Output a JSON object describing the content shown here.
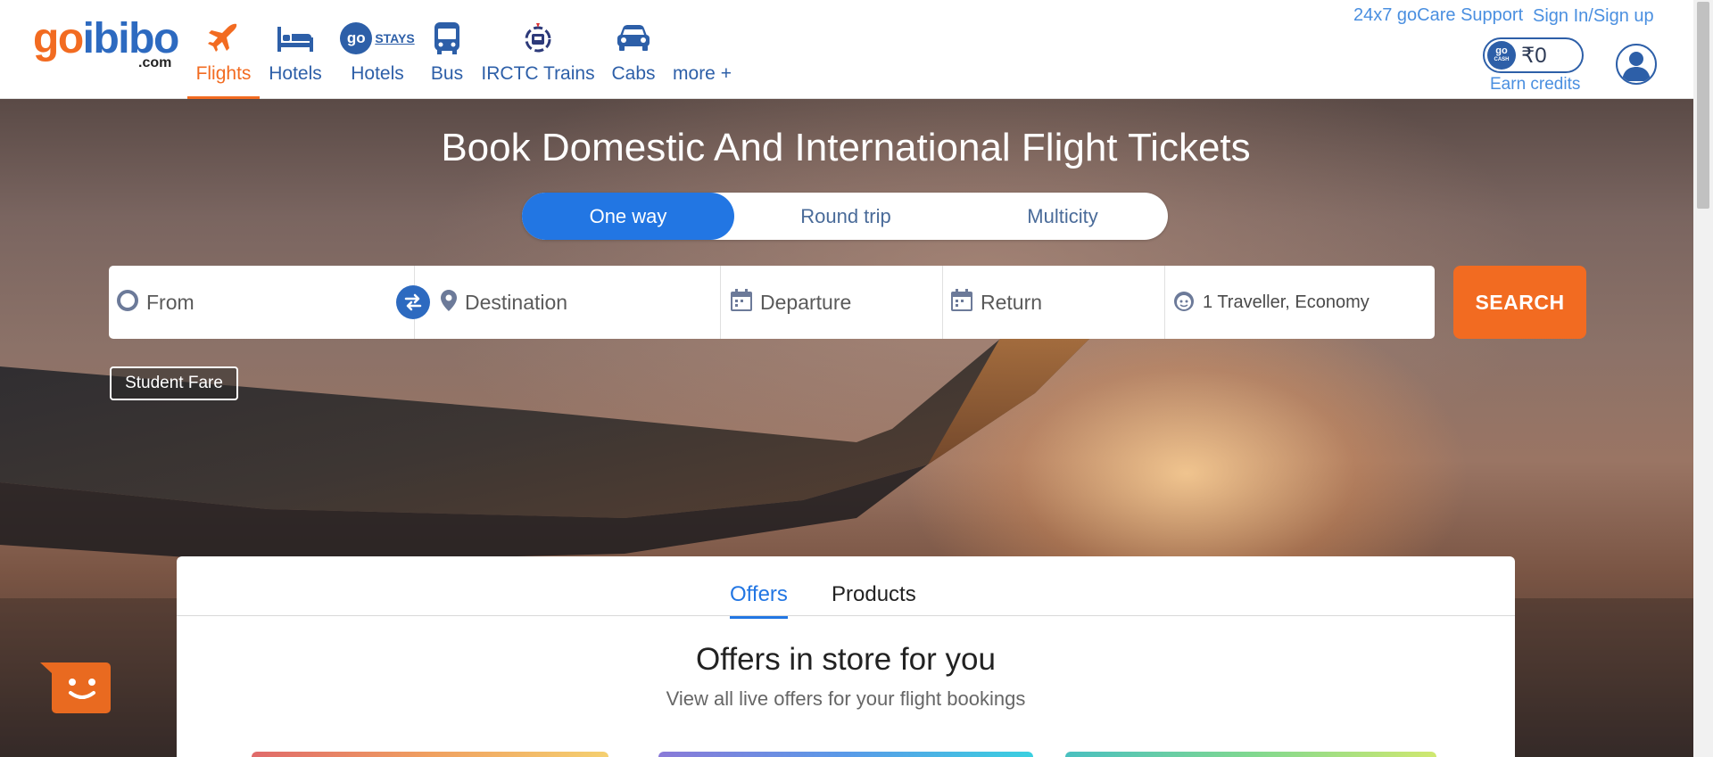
{
  "header": {
    "logo": {
      "word_go": "go",
      "word_ibibo": "ibibo",
      "suffix": ".com"
    },
    "nav": [
      {
        "label": "Flights",
        "icon": "airplane-icon",
        "active": true
      },
      {
        "label": "Hotels",
        "icon": "bed-icon"
      },
      {
        "label": "Hotels",
        "icon": "gostays-icon",
        "badge": "STAYS",
        "badge_prefix": "go"
      },
      {
        "label": "Bus",
        "icon": "bus-icon"
      },
      {
        "label": "IRCTC Trains",
        "icon": "irctc-icon"
      },
      {
        "label": "Cabs",
        "icon": "car-icon"
      },
      {
        "label": "more +"
      }
    ],
    "support_link": "24x7 goCare Support",
    "signin_link": "Sign In/Sign up",
    "gocash": {
      "coin_line1": "go",
      "coin_line2": "CASH",
      "amount": "₹0"
    },
    "earn_credits": "Earn credits"
  },
  "hero": {
    "title": "Book Domestic And International Flight Tickets",
    "trip_types": [
      "One way",
      "Round trip",
      "Multicity"
    ],
    "selected_trip": "One way",
    "search": {
      "from_placeholder": "From",
      "destination_placeholder": "Destination",
      "departure_placeholder": "Departure",
      "return_placeholder": "Return",
      "travellers": "1 Traveller, Economy",
      "button": "SEARCH"
    },
    "student_fare": "Student Fare"
  },
  "offers_panel": {
    "tabs": [
      "Offers",
      "Products"
    ],
    "active_tab": "Offers",
    "title": "Offers in store for you",
    "subtitle": "View all live offers for your flight bookings"
  },
  "colors": {
    "brand_orange": "#f26b21",
    "brand_blue": "#2d6ac0",
    "accent_blue": "#2276e3"
  }
}
